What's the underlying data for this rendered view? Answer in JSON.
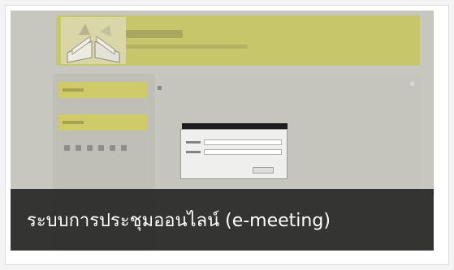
{
  "card": {
    "caption": "ระบบการประชุมออนไลน์ (e-meeting)"
  },
  "colors": {
    "app_header": "#c8c66a",
    "sidebar_item": "#cfcb69",
    "caption_background": "#232323",
    "caption_text": "#ffffff"
  },
  "icons": {
    "logo": "open-book-icon"
  }
}
